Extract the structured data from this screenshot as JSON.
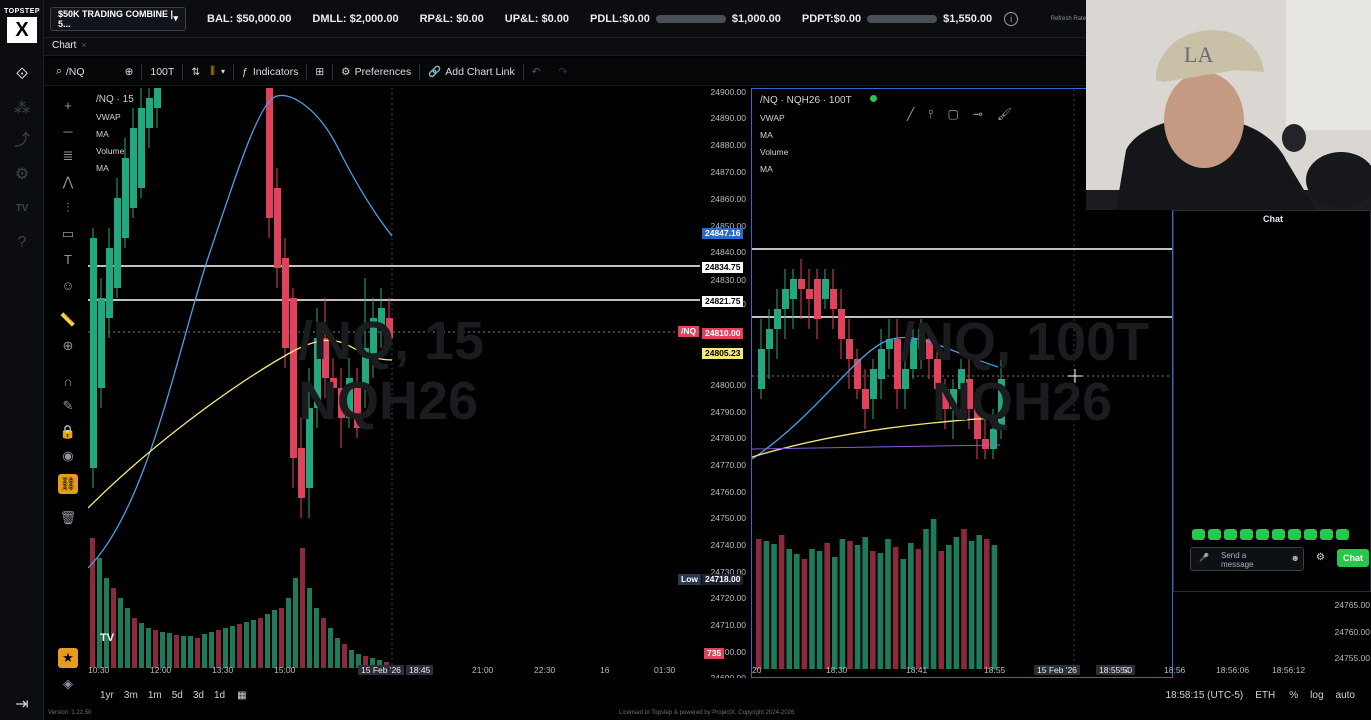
{
  "brand": {
    "line1": "TOPSTEP",
    "mark": "X"
  },
  "topbar": {
    "account": "$50K TRADING COMBINE | 5...",
    "bal": "BAL: $50,000.00",
    "dmll": "DMLL: $2,000.00",
    "rpl": "RP&L: $0.00",
    "upl": "UP&L: $0.00",
    "pdll": "PDLL:$0.00",
    "pdll_max": "$1,000.00",
    "pdpt": "PDPT:$0.00",
    "pdpt_max": "$1,550.00",
    "refresh": "Refresh Rate"
  },
  "tabs": {
    "chart": "Chart",
    "close": "×"
  },
  "toolbar": {
    "search": "/NQ",
    "interval": "100T",
    "indicators": "Indicators",
    "preferences": "Preferences",
    "add_link": "Add Chart Link"
  },
  "left_chart": {
    "symbol": "/NQ · 15",
    "legend": [
      "VWAP",
      "MA",
      "Volume",
      "MA"
    ],
    "watermark_1": "/NQ, 15",
    "watermark_2": "NQH26",
    "prices": [
      "24900.00",
      "24890.00",
      "24880.00",
      "24870.00",
      "24860.00",
      "24850.00",
      "24840.00",
      "24830.00",
      "24820.00",
      "24800.00",
      "24790.00",
      "24780.00",
      "24770.00",
      "24760.00",
      "24750.00",
      "24740.00",
      "24730.00",
      "24720.00",
      "24710.00",
      "24700.00",
      "24690.00"
    ],
    "label_blue": "24847.16",
    "label_white1": "24834.75",
    "label_white2": "24821.75",
    "label_nq_tag": "/NQ",
    "label_last": "24810.00",
    "label_yellow": "24805.23",
    "label_low_tag": "Low",
    "label_low": "24718.00",
    "label_vol": "735"
  },
  "right_chart": {
    "symbol": "/NQ · NQH26 · 100T",
    "legend": [
      "VWAP",
      "MA",
      "Volume",
      "MA"
    ],
    "watermark_1": "/NQ, 100T",
    "watermark_2": "NQH26"
  },
  "time_axis": {
    "labels": [
      "10:30",
      "12:00",
      "13:30",
      "15:00",
      "15 Feb '26",
      "18:45",
      "21:00",
      "22:30",
      "16",
      "01:30",
      "20",
      "18:30",
      "18:41",
      "18:55",
      "15 Feb '26",
      "18:55:50",
      "54",
      "18:56",
      "18:56:06",
      "18:56:12"
    ]
  },
  "right_prices": [
    "24765.00",
    "24760.00",
    "24755.00"
  ],
  "bottombar": {
    "ranges": [
      "1yr",
      "3m",
      "1m",
      "5d",
      "3d",
      "1d"
    ],
    "clock": "18:58:15 (UTC-5)",
    "session": "ETH",
    "pct": "%",
    "log": "log",
    "auto": "auto"
  },
  "footer": {
    "version": "Version: 1.22.50",
    "license": "Licensed to Topstep & powered by ProjectX. Copyright 2024-2026"
  },
  "chat": {
    "title": "Chat",
    "placeholder_1": "Send a",
    "placeholder_2": "message",
    "send": "Chat"
  },
  "colors": {
    "accent_blue": "#2a6cc8",
    "up": "#22a77e",
    "down": "#e0425b",
    "highlight": "#e59b1c"
  }
}
